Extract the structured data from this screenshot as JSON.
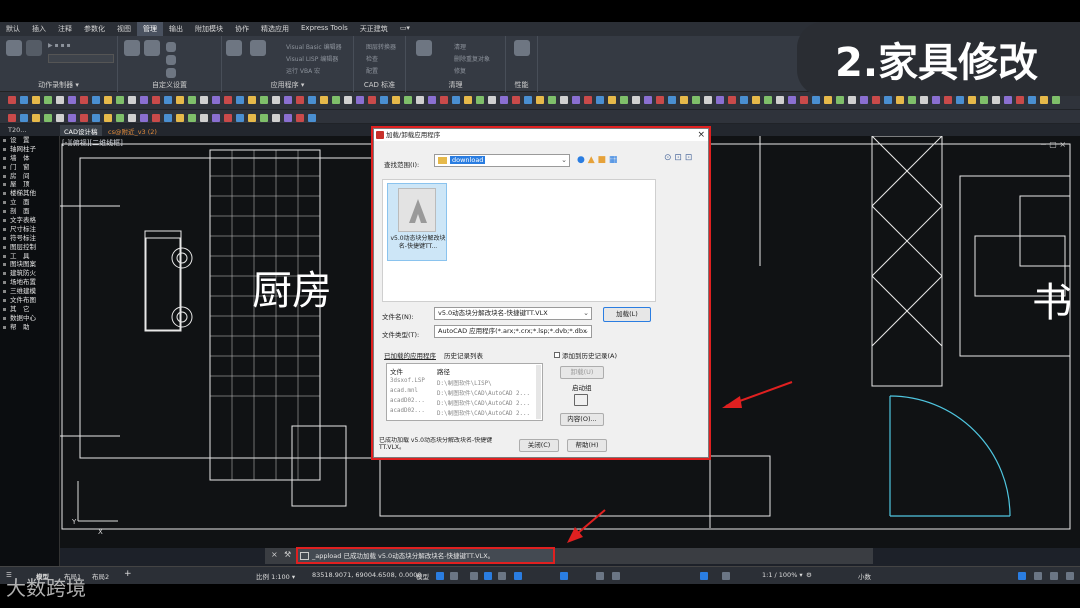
{
  "overlay": {
    "title": "2.家具修改",
    "watermark": "大数跨境"
  },
  "ribbon": {
    "tabs": [
      "默认",
      "插入",
      "注释",
      "参数化",
      "视图",
      "管理",
      "输出",
      "附加模块",
      "协作",
      "精选应用",
      "Express Tools",
      "天正建筑",
      "▭▾"
    ],
    "active_tab": "管理",
    "groups": [
      "动作录制器 ▾",
      "自定义设置",
      "应用程序 ▾",
      "CAD 标准",
      "清理",
      "性能"
    ],
    "app_items": [
      "Visual Basic 编辑器",
      "Visual LISP 编辑器",
      "运行 VBA 宏"
    ],
    "cad_items": [
      "图层转换器",
      "检查",
      "配置"
    ],
    "clean_items": [
      "清理",
      "删除重复对象",
      "修复"
    ]
  },
  "doc": {
    "tabs": [
      "T20...",
      "CAD设计稿",
      "cs@附近_v3 (2)"
    ],
    "viewport_label": "[-][俯视][二维线框]"
  },
  "sidebar": [
    "设　置",
    "轴网柱子",
    "墙　体",
    "门　窗",
    "房　间",
    "屋　顶",
    "楼梯其他",
    "立　面",
    "剖　面",
    "文字表格",
    "尺寸标注",
    "符号标注",
    "图层控制",
    "工　具",
    "图块图案",
    "建筑防火",
    "场地布置",
    "三维建模",
    "文件布图",
    "其　它",
    "数据中心",
    "帮　助"
  ],
  "rooms": {
    "kitchen": "厨房",
    "study": "书"
  },
  "dialog": {
    "title": "加载/卸载应用程序",
    "lookin_label": "查找范围(I):",
    "lookin_value": "download",
    "file_item": "v5.0动态块分解改块名-快捷键TT...",
    "filename_label": "文件名(N):",
    "filename_value": "v5.0动态块分解改块名-快捷键TT.VLX",
    "filetype_label": "文件类型(T):",
    "filetype_value": "AutoCAD 应用程序(*.arx;*.crx;*.lsp;*.dvb;*.dbx",
    "load_button": "加载(L)",
    "loaded_tab": "已加载的应用程序",
    "history_tab": "历史记录列表",
    "add_history": "添加到历史记录(A)",
    "col_file": "文件",
    "col_path": "路径",
    "rows": [
      {
        "file": "3dsxof.LSP",
        "path": "D:\\制图软件\\LISP\\"
      },
      {
        "file": "acad.mnl",
        "path": "D:\\制图软件\\CAD\\AutoCAD 2..."
      },
      {
        "file": "acadD02...",
        "path": "D:\\制图软件\\CAD\\AutoCAD 2..."
      },
      {
        "file": "acadD02...",
        "path": "D:\\制图软件\\CAD\\AutoCAD 2..."
      }
    ],
    "unload_button": "卸载(U)",
    "startup_label": "启动组",
    "contents_button": "内容(O)...",
    "status": "已成功加载 v5.0动态块分解改块名-快捷键TT.VLX。",
    "close_button": "关闭(C)",
    "help_button": "帮助(H)"
  },
  "command": {
    "text": "_appload 已成功加载 v5.0动态块分解改块名-快捷键TT.VLX。"
  },
  "layout_tabs": [
    "布局1",
    "布局2",
    "+"
  ],
  "status": {
    "scale": "比例 1:100 ▾",
    "coords": "83518.9071, 69004.6508, 0.0000",
    "model": "模型",
    "zoom": "1:1 / 100% ▾",
    "units": "小数"
  },
  "colors": {
    "highlight": "#e02020",
    "accent": "#2a7de1",
    "door_line": "#4fc6e0"
  }
}
